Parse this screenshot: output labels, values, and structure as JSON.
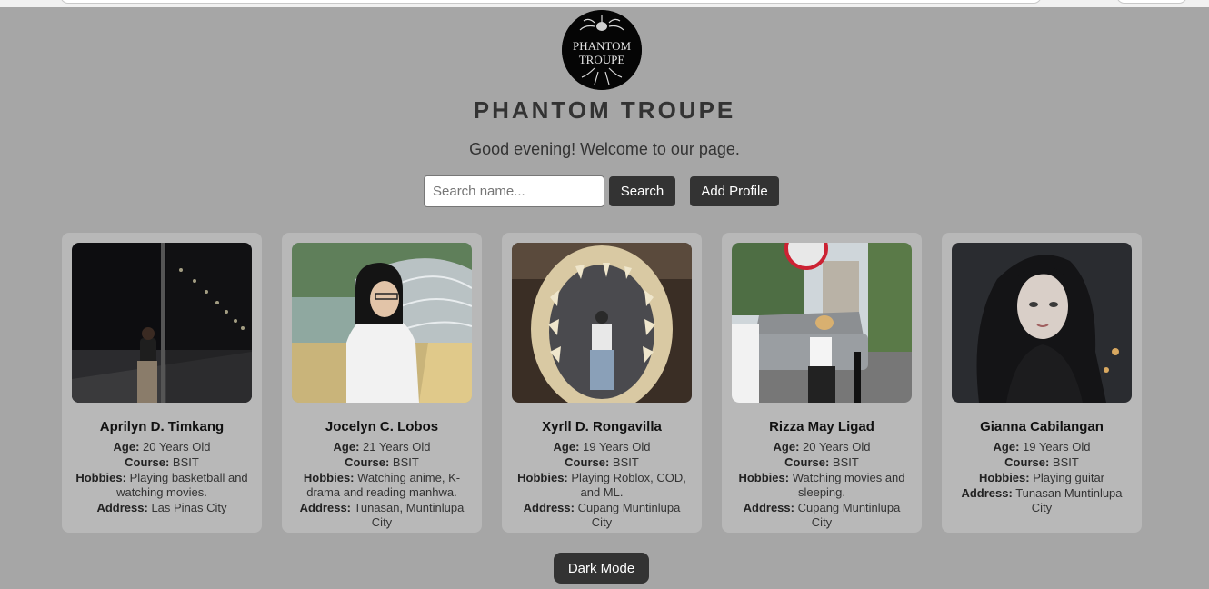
{
  "header": {
    "title": "PHANTOM TROUPE",
    "greeting": "Good evening! Welcome to our page.",
    "logo_text_line1": "PHANTOM",
    "logo_text_line2": "TROUPE"
  },
  "search": {
    "placeholder": "Search name...",
    "value": "",
    "button_label": "Search"
  },
  "add_profile_label": "Add Profile",
  "dark_mode_label": "Dark Mode",
  "labels": {
    "age": "Age:",
    "course": "Course:",
    "hobbies": "Hobbies:",
    "address": "Address:"
  },
  "profiles": [
    {
      "name": "Aprilyn D. Timkang",
      "age": "20 Years Old",
      "course": "BSIT",
      "hobbies": "Playing basketball and watching movies.",
      "address": "Las Pinas City"
    },
    {
      "name": "Jocelyn C. Lobos",
      "age": "21 Years Old",
      "course": "BSIT",
      "hobbies": "Watching anime, K-drama and reading manhwa.",
      "address": "Tunasan, Muntinlupa City"
    },
    {
      "name": "Xyrll D. Rongavilla",
      "age": "19 Years Old",
      "course": "BSIT",
      "hobbies": "Playing Roblox, COD, and ML.",
      "address": "Cupang Muntinlupa City"
    },
    {
      "name": "Rizza May Ligad",
      "age": "20 Years Old",
      "course": "BSIT",
      "hobbies": "Watching movies and sleeping.",
      "address": "Cupang Muntinlupa City"
    },
    {
      "name": "Gianna Cabilangan",
      "age": "19 Years Old",
      "course": "BSIT",
      "hobbies": "Playing guitar",
      "address": "Tunasan Muntinlupa City"
    }
  ],
  "colors": {
    "page_background": "#a6a6a6",
    "card_background": "#b8b8b8",
    "button_background": "#333333",
    "button_text": "#ffffff"
  }
}
